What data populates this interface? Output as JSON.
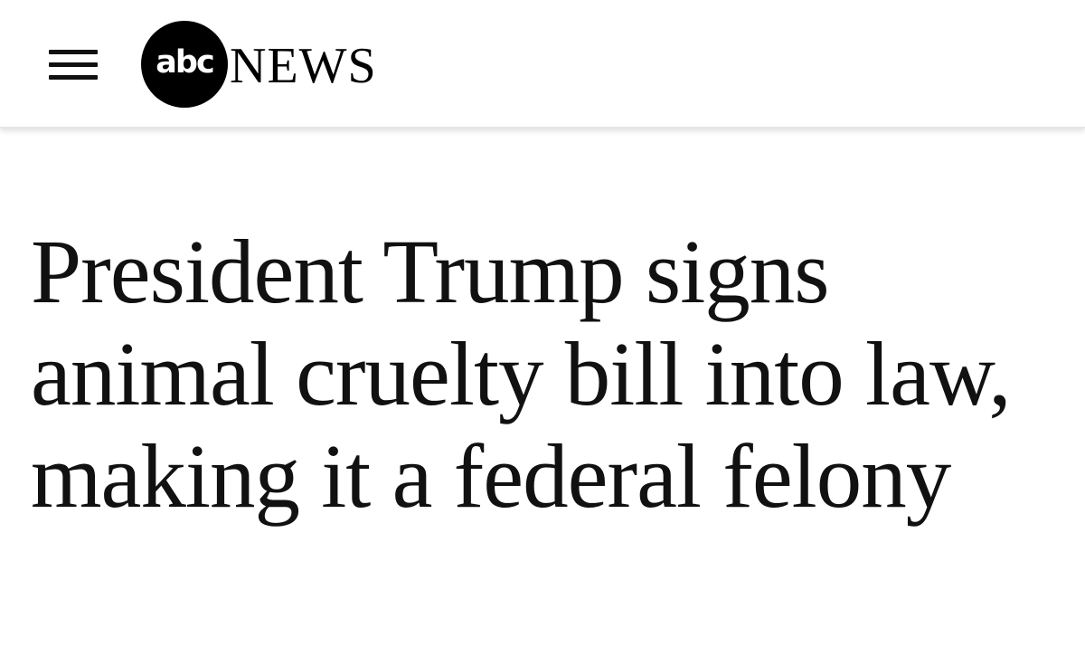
{
  "header": {
    "menu_icon": "hamburger-menu-icon",
    "logo": {
      "mark_text": "abc",
      "wordmark": "NEWS"
    }
  },
  "article": {
    "headline": "President Trump signs animal cruelty bill into law, making it a federal felony"
  },
  "colors": {
    "background": "#ffffff",
    "text": "#111111",
    "logo": "#000000"
  }
}
